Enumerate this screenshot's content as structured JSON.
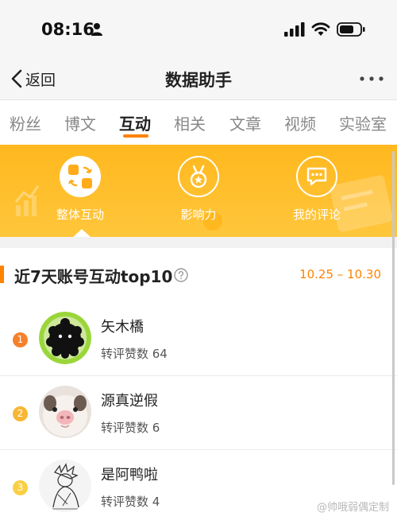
{
  "status_bar": {
    "time": "08:16"
  },
  "nav": {
    "back_label": "返回",
    "title": "数据助手"
  },
  "tabs": [
    {
      "label": "粉丝"
    },
    {
      "label": "博文"
    },
    {
      "label": "互动",
      "active": true
    },
    {
      "label": "相关"
    },
    {
      "label": "文章"
    },
    {
      "label": "视频"
    },
    {
      "label": "实验室"
    }
  ],
  "features": [
    {
      "label": "整体互动",
      "icon": "overall-interaction-icon",
      "active": true
    },
    {
      "label": "影响力",
      "icon": "influence-medal-icon"
    },
    {
      "label": "我的评论",
      "icon": "my-comments-icon"
    }
  ],
  "section": {
    "title": "近7天账号互动top10",
    "date_range": "10.25 – 10.30"
  },
  "ranking": [
    {
      "rank": "1",
      "name": "矢木橋",
      "stat": "转评赞数 64"
    },
    {
      "rank": "2",
      "name": "源真逆假",
      "stat": "转评赞数 6"
    },
    {
      "rank": "3",
      "name": "是阿鸭啦",
      "stat": "转评赞数 4"
    }
  ],
  "watermark": "@帅哦弱偶定制",
  "colors": {
    "accent": "#ff8200",
    "banner": "#ffbf2f",
    "rank_1": "#f6812a",
    "rank_2": "#f7b733",
    "rank_3": "#f9cf45"
  }
}
